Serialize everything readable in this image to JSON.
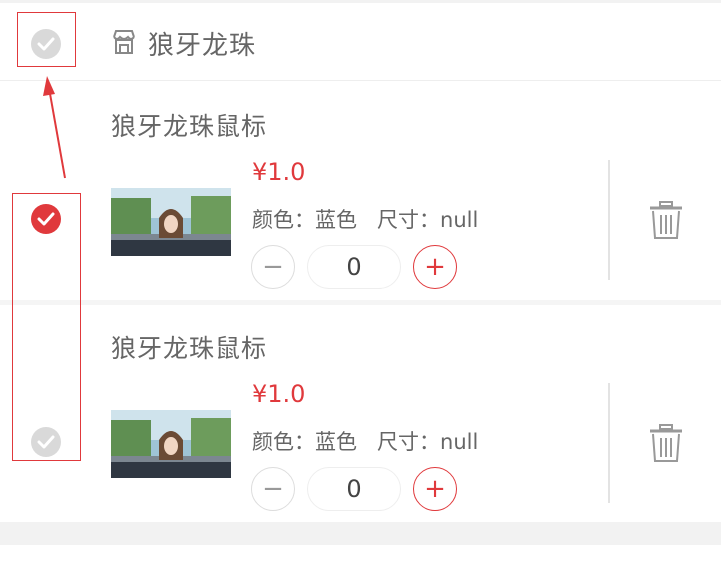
{
  "store": {
    "name": "狼牙龙珠",
    "checked": false,
    "icon": "store-icon"
  },
  "items": [
    {
      "title": "狼牙龙珠鼠标",
      "price": "¥1.0",
      "spec": "颜色：蓝色   尺寸：null",
      "quantity": "0",
      "checked": true,
      "minus_label": "−",
      "plus_label": "+"
    },
    {
      "title": "狼牙龙珠鼠标",
      "price": "¥1.0",
      "spec": "颜色：蓝色   尺寸：null",
      "quantity": "0",
      "checked": false,
      "minus_label": "−",
      "plus_label": "+"
    }
  ],
  "colors": {
    "accent": "#e0393c",
    "unchecked": "#d9d9d9",
    "text": "#666666"
  }
}
